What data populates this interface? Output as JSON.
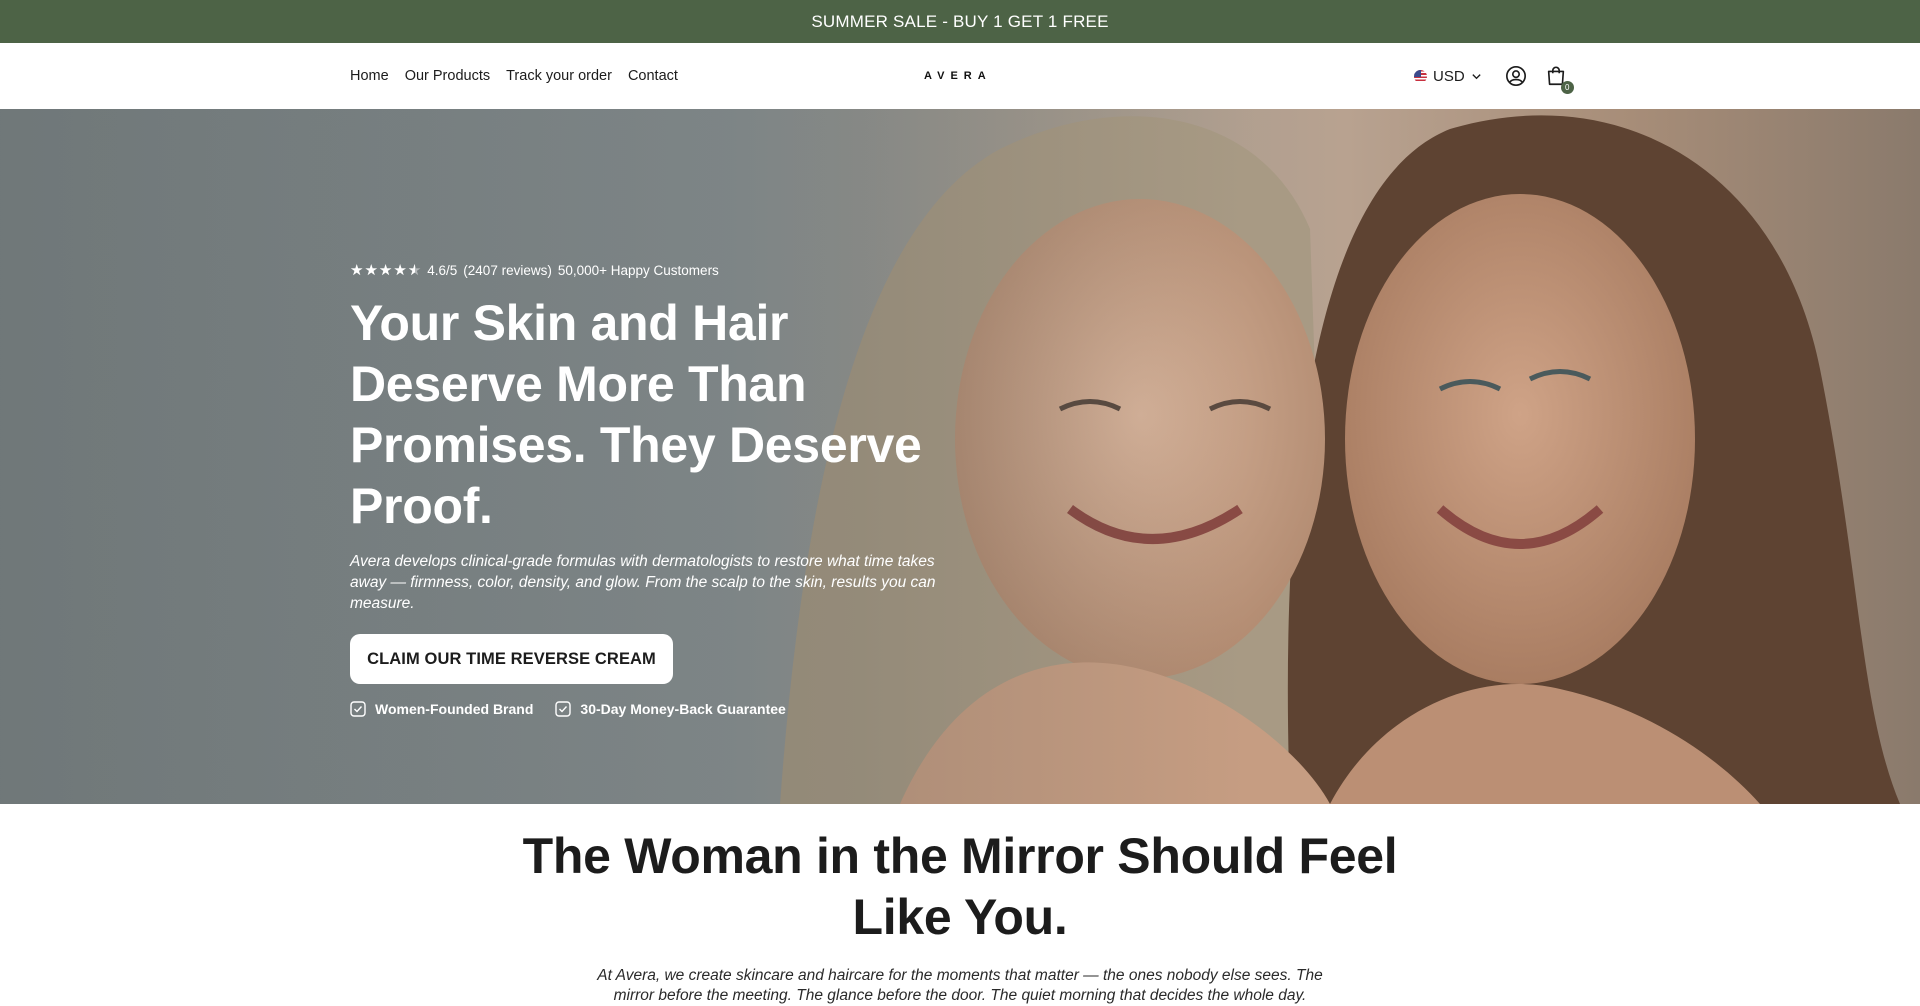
{
  "announcement": {
    "text": "SUMMER SALE - BUY 1 GET 1 FREE"
  },
  "header": {
    "nav": [
      "Home",
      "Our Products",
      "Track your order",
      "Contact"
    ],
    "logo": "AVERA",
    "currency": "USD",
    "cart_count": "0"
  },
  "hero": {
    "rating_score": "4.6/5",
    "rating_reviews": "(2407 reviews)",
    "rating_customers": "50,000+ Happy Customers",
    "stars_filled": 4.5,
    "title": "Your Skin and Hair Deserve More Than Promises. They Deserve Proof.",
    "subtitle": "Avera develops clinical-grade formulas with dermatologists to restore what time takes away — firmness, color, density, and glow. From the scalp to the skin, results you can measure.",
    "cta_label": "CLAIM OUR TIME REVERSE CREAM",
    "badges": [
      "Women-Founded Brand",
      "30-Day Money-Back Guarantee"
    ]
  },
  "section2": {
    "title": "The Woman in the Mirror Should Feel Like You.",
    "body": "At Avera, we create skincare and haircare for the moments that matter — the ones nobody else sees. The mirror before the meeting. The glance before the door. The quiet morning that decides the whole day."
  },
  "colors": {
    "brand": "#4d6346",
    "text": "#1c1c1c"
  }
}
